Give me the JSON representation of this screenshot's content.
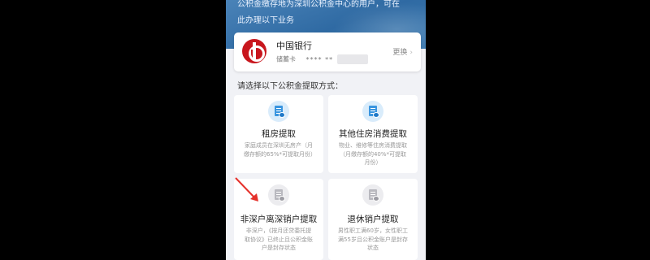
{
  "banner": {
    "line1": "公积金缴存地为深圳公积金中心的用户，可在",
    "line2": "此办理以下业务"
  },
  "bank_card": {
    "name": "中国银行",
    "card_type": "储蓄卡",
    "card_mask": "**** **",
    "change_label": "更换"
  },
  "section_title": "请选择以下公积金提取方式：",
  "options": [
    {
      "title": "租房提取",
      "desc": "家庭成员在深圳无房产（月缴存额的65%*可提取月份）",
      "icon": "house-document-icon"
    },
    {
      "title": "其他住房消费提取",
      "desc": "物业、维修等住房消费提取（月缴存额的40%*可提取月份）",
      "icon": "house-document-icon"
    },
    {
      "title": "非深户离深销户提取",
      "desc": "非深户，《按月还贷委托提取协议》已终止且公积金账户是封存状态",
      "icon": "id-card-icon"
    },
    {
      "title": "退休销户提取",
      "desc": "男性职工满60岁，女性职工满55岁且公积金账户是封存状态",
      "icon": "person-document-icon"
    }
  ],
  "colors": {
    "bank_red": "#c8161d",
    "icon_blue": "#3a95df",
    "annotation_arrow": "#e5312b"
  }
}
